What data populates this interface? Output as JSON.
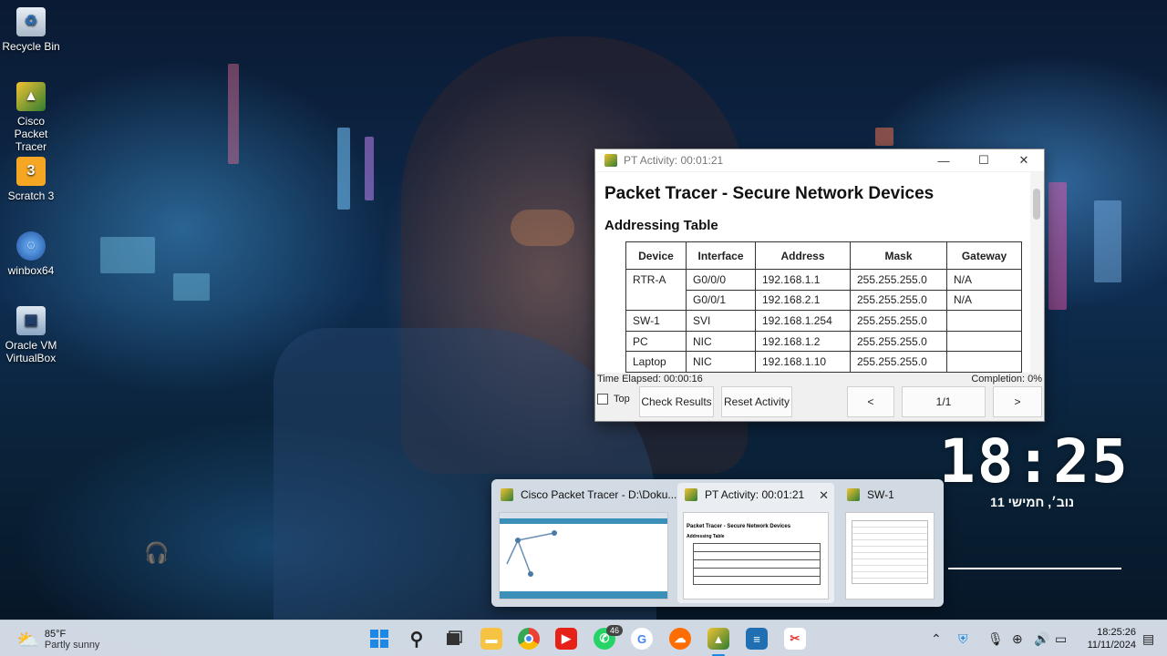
{
  "desktop_icons": [
    {
      "label": "Recycle Bin",
      "icon": "recycle-bin-icon"
    },
    {
      "label": "Cisco Packet Tracer",
      "icon": "cisco-packet-tracer-icon"
    },
    {
      "label": "Scratch 3",
      "icon": "scratch-icon"
    },
    {
      "label": "winbox64",
      "icon": "winbox-icon"
    },
    {
      "label": "Oracle VM VirtualBox",
      "icon": "virtualbox-icon"
    }
  ],
  "pt_window": {
    "title": "PT Activity: 00:01:21",
    "heading": "Packet Tracer - Secure Network Devices",
    "subheading": "Addressing Table",
    "table": {
      "headers": [
        "Device",
        "Interface",
        "Address",
        "Mask",
        "Gateway"
      ],
      "rows": [
        {
          "device": "RTR-A",
          "interface": "G0/0/0",
          "address": "192.168.1.1",
          "mask": "255.255.255.0",
          "gateway": "N/A"
        },
        {
          "device": "",
          "interface": "G0/0/1",
          "address": "192.168.2.1",
          "mask": "255.255.255.0",
          "gateway": "N/A"
        },
        {
          "device": "SW-1",
          "interface": "SVI",
          "address": "192.168.1.254",
          "mask": "255.255.255.0",
          "gateway": ""
        },
        {
          "device": "PC",
          "interface": "NIC",
          "address": "192.168.1.2",
          "mask": "255.255.255.0",
          "gateway": ""
        },
        {
          "device": "Laptop",
          "interface": "NIC",
          "address": "192.168.1.10",
          "mask": "255.255.255.0",
          "gateway": ""
        }
      ]
    },
    "time_elapsed": "Time Elapsed: 00:00:16",
    "completion": "Completion: 0%",
    "top_label": "Top",
    "check_results": "Check Results",
    "reset_activity": "Reset Activity",
    "prev": "<",
    "page": "1/1",
    "next": ">"
  },
  "clock": {
    "time": "18:25",
    "date": "11 נוב׳, חמישי"
  },
  "preview": {
    "items": [
      {
        "title": "Cisco Packet Tracer - D:\\Doku..."
      },
      {
        "title": "PT Activity: 00:01:21",
        "thumb_heading": "Packet Tracer - Secure Network Devices",
        "thumb_sub": "Addressing Table"
      },
      {
        "title": "SW-1"
      }
    ]
  },
  "taskbar": {
    "weather_temp": "85°F",
    "weather_desc": "Partly sunny",
    "whatsapp_badge": "46",
    "time": "18:25:26",
    "date": "11/11/2024"
  }
}
